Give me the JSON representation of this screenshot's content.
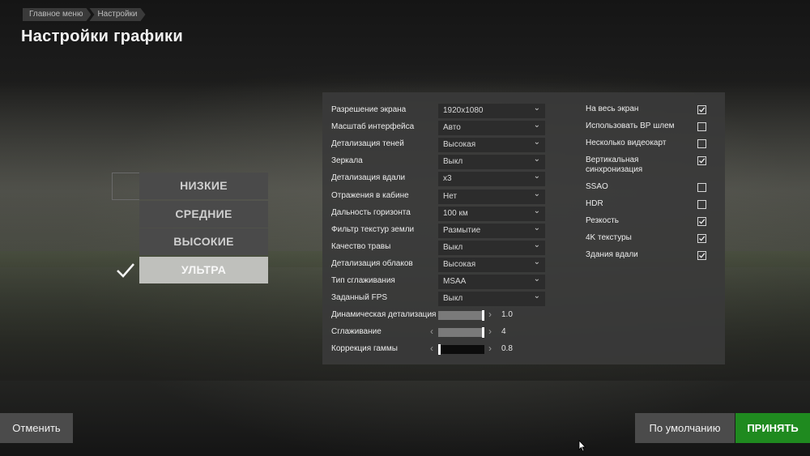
{
  "breadcrumb": [
    "Главное меню",
    "Настройки"
  ],
  "page_title": "Настройки графики",
  "presets": [
    {
      "label": "НИЗКИЕ",
      "checked": false,
      "show_box": true
    },
    {
      "label": "СРЕДНИЕ",
      "checked": false,
      "show_box": false
    },
    {
      "label": "ВЫСОКИЕ",
      "checked": false,
      "show_box": false
    },
    {
      "label": "УЛЬТРА",
      "checked": true,
      "show_box": false
    }
  ],
  "settings": [
    {
      "label": "Разрешение экрана",
      "value": "1920x1080"
    },
    {
      "label": "Масштаб интерфейса",
      "value": "Авто"
    },
    {
      "label": "Детализация теней",
      "value": "Высокая"
    },
    {
      "label": "Зеркала",
      "value": "Выкл"
    },
    {
      "label": "Детализация вдали",
      "value": "x3"
    },
    {
      "label": "Отражения в кабине",
      "value": "Нет"
    },
    {
      "label": "Дальность горизонта",
      "value": "100 км"
    },
    {
      "label": "Фильтр текстур земли",
      "value": "Размытие"
    },
    {
      "label": "Качество травы",
      "value": "Выкл"
    },
    {
      "label": "Детализация облаков",
      "value": "Высокая"
    },
    {
      "label": "Тип сглаживания",
      "value": "MSAA"
    },
    {
      "label": "Заданный FPS",
      "value": "Выкл"
    }
  ],
  "sliders": [
    {
      "label": "Динамическая детализация",
      "value": "1.0",
      "fraction": 1.0
    },
    {
      "label": "Сглаживание",
      "value": "4",
      "fraction": 1.0
    },
    {
      "label": "Коррекция гаммы",
      "value": "0.8",
      "fraction": 0.0
    }
  ],
  "toggles": [
    {
      "label": "На весь экран",
      "checked": true
    },
    {
      "label": "Использовать ВР шлем",
      "checked": false
    },
    {
      "label": "Несколько видеокарт",
      "checked": false
    },
    {
      "label": "Вертикальная синхронизация",
      "checked": true
    },
    {
      "label": "SSAO",
      "checked": false
    },
    {
      "label": "HDR",
      "checked": false
    },
    {
      "label": "Резкость",
      "checked": true
    },
    {
      "label": "4K текстуры",
      "checked": true
    },
    {
      "label": "Здания вдали",
      "checked": true
    }
  ],
  "buttons": {
    "cancel": "Отменить",
    "default": "По умолчанию",
    "accept": "ПРИНЯТЬ"
  },
  "colors": {
    "accept": "#1f8a1f",
    "active_preset": "#bfc0bc"
  }
}
